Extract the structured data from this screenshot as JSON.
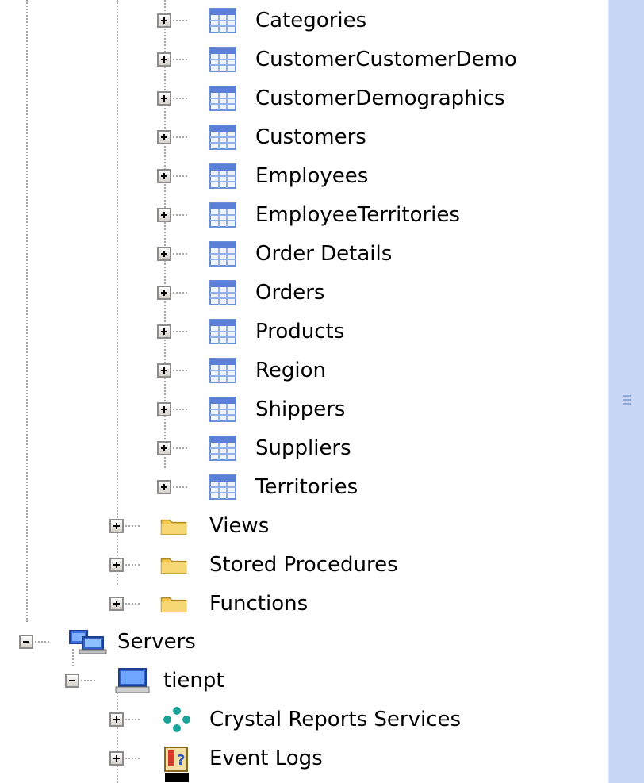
{
  "tree": {
    "tables": [
      "Categories",
      "CustomerCustomerDemo",
      "CustomerDemographics",
      "Customers",
      "Employees",
      "EmployeeTerritories",
      "Order Details",
      "Orders",
      "Products",
      "Region",
      "Shippers",
      "Suppliers",
      "Territories"
    ],
    "folders": [
      "Views",
      "Stored Procedures",
      "Functions"
    ],
    "servers_label": "Servers",
    "server_name": "tienpt",
    "services": [
      "Crystal Reports Services",
      "Event Logs"
    ]
  },
  "icons": {
    "table": "table-icon",
    "folder": "folder-icon",
    "servers": "servers-icon",
    "computer": "computer-icon",
    "crystal": "crystal-reports-icon",
    "eventlog": "event-log-icon"
  },
  "colors": {
    "scrollbar_track": "#c8d7f5",
    "tree_line": "#a8a8a8",
    "folder": "#f2c94c",
    "table_header": "#5b7fd6"
  }
}
